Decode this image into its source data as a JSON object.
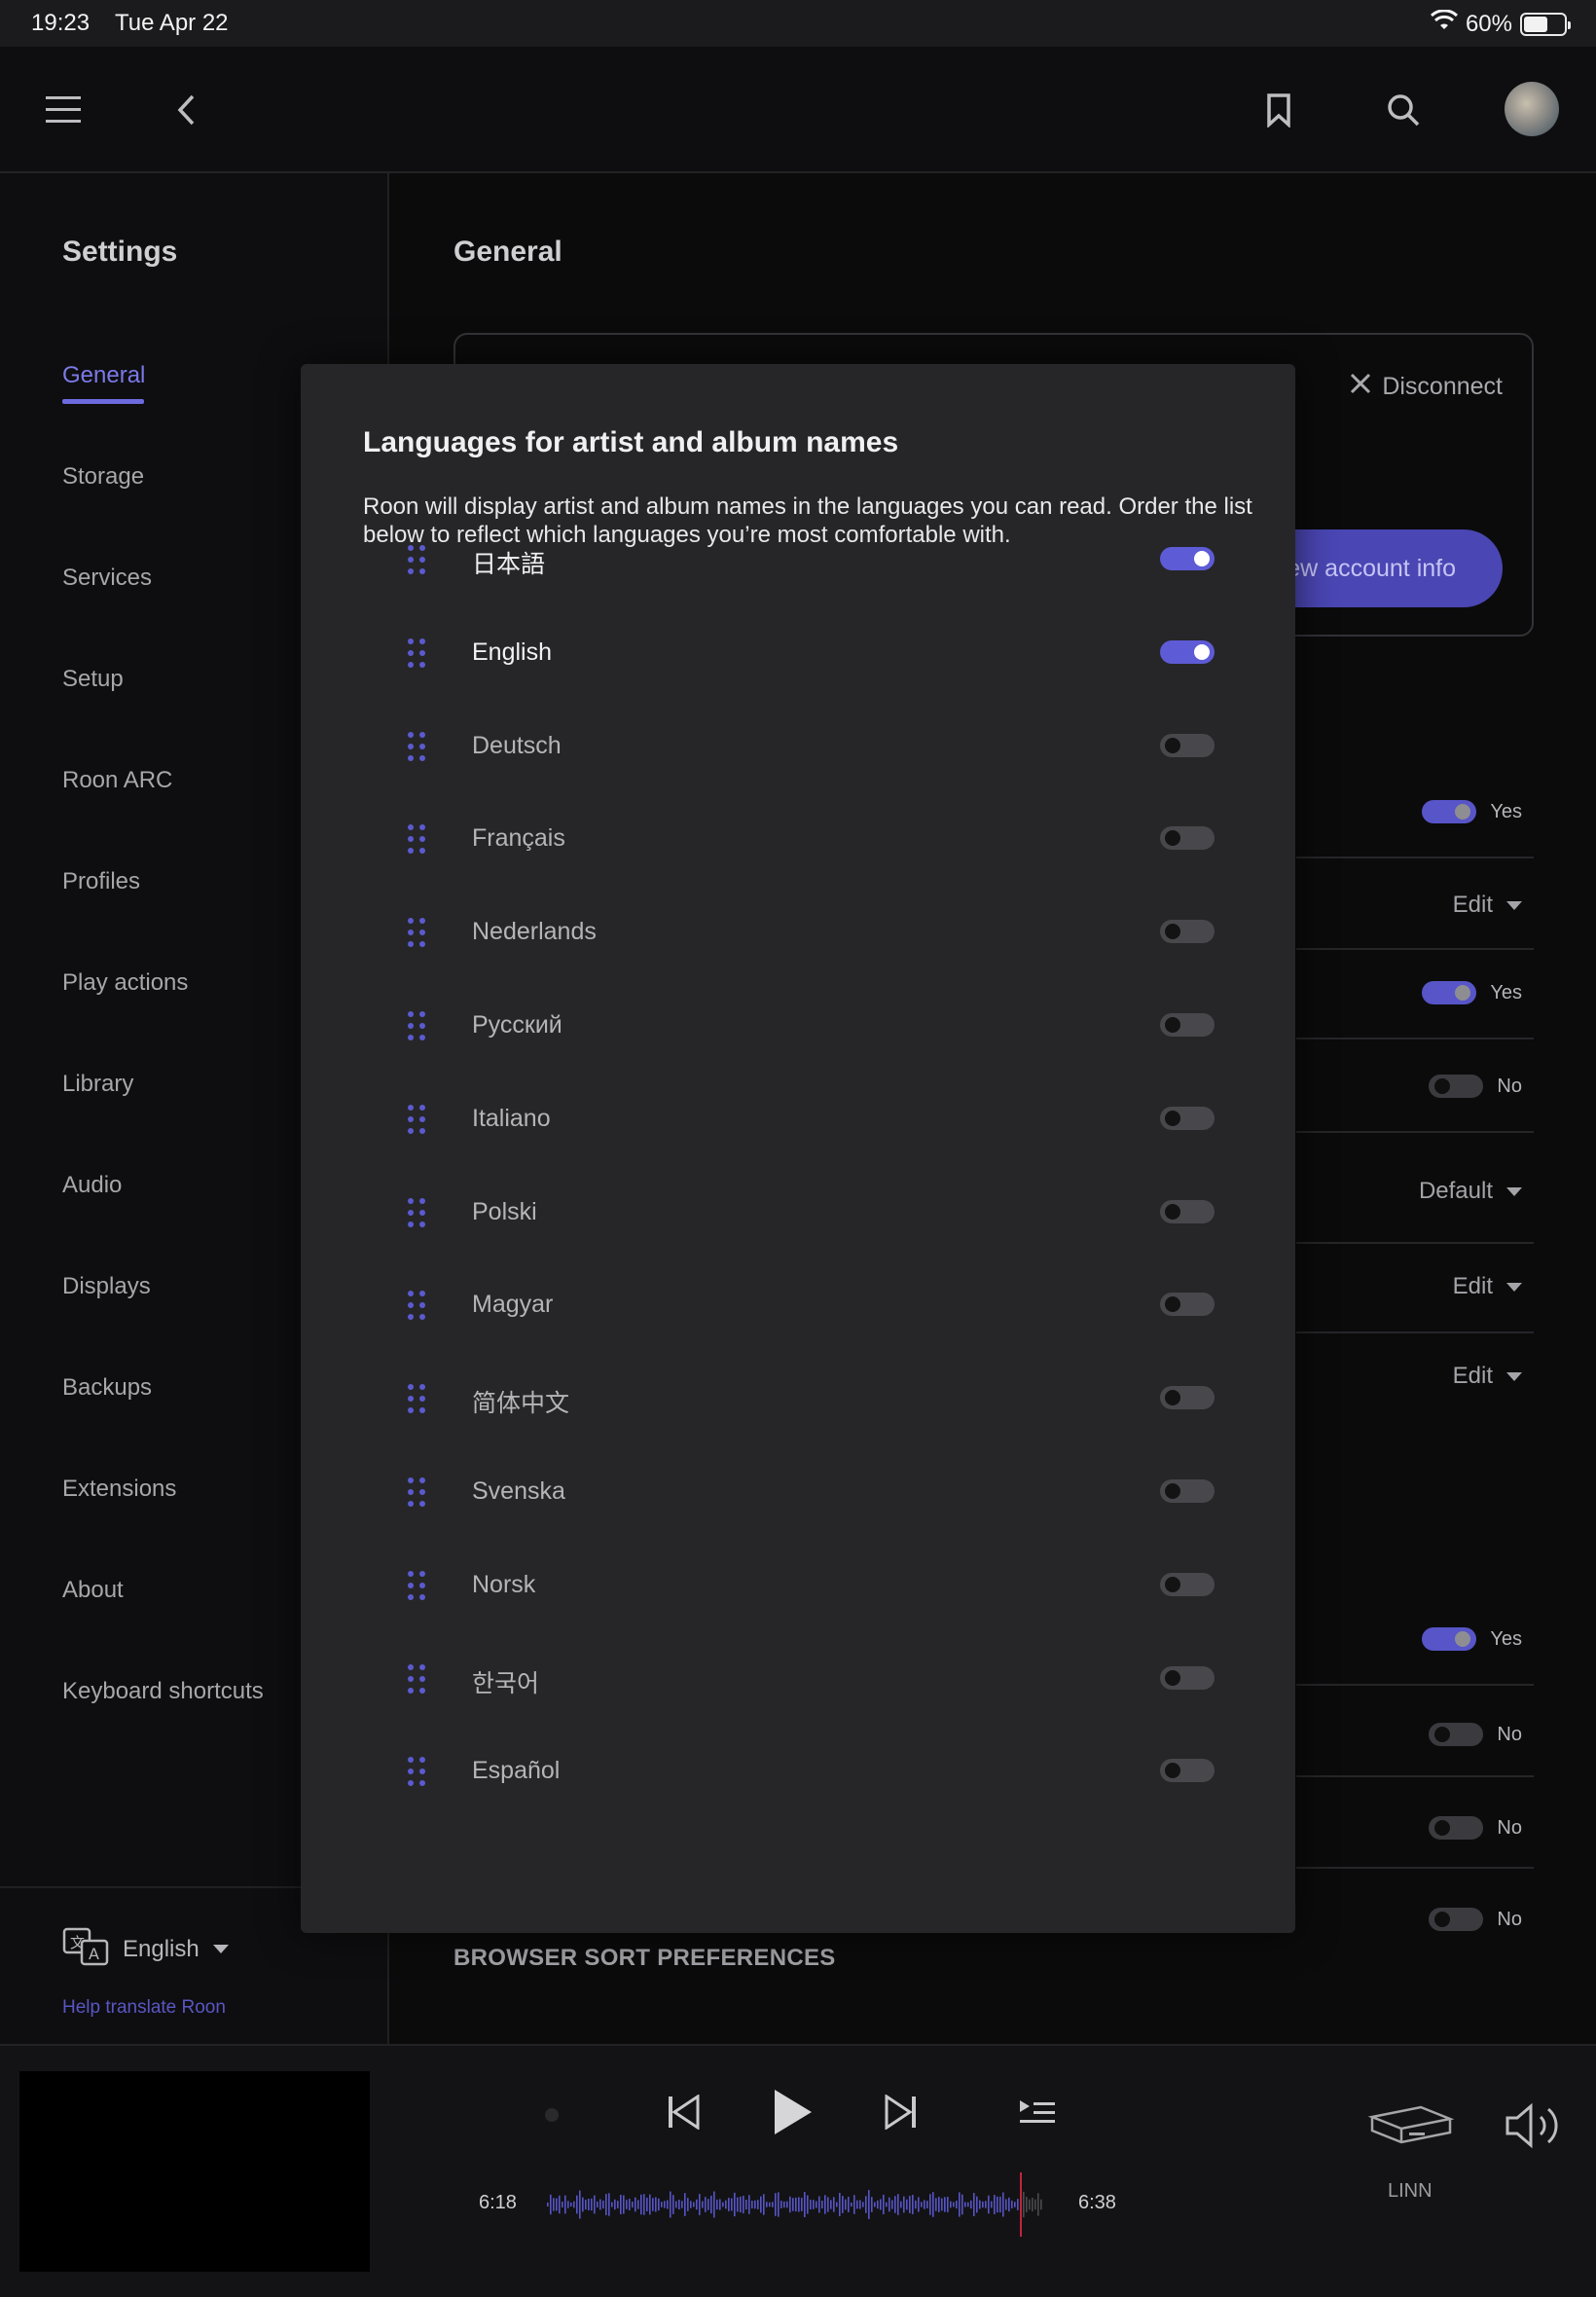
{
  "status_bar": {
    "time": "19:23",
    "date": "Tue Apr 22",
    "battery": "60%",
    "battery_level": 0.6
  },
  "top_nav": {
    "icons": [
      "hamburger-menu-icon",
      "back-chevron-icon",
      "bookmark-icon",
      "search-icon"
    ]
  },
  "sidebar": {
    "title": "Settings",
    "items": [
      {
        "label": "General",
        "active": true
      },
      {
        "label": "Storage"
      },
      {
        "label": "Services"
      },
      {
        "label": "Setup"
      },
      {
        "label": "Roon ARC"
      },
      {
        "label": "Profiles"
      },
      {
        "label": "Play actions"
      },
      {
        "label": "Library"
      },
      {
        "label": "Audio"
      },
      {
        "label": "Displays"
      },
      {
        "label": "Backups"
      },
      {
        "label": "Extensions"
      },
      {
        "label": "About"
      },
      {
        "label": "Keyboard shortcuts"
      }
    ],
    "language_selector": "English",
    "help_translate": "Help translate Roon"
  },
  "main": {
    "title": "General",
    "account": {
      "disconnect_label": "Disconnect",
      "view_account_label": "ew account info"
    },
    "settings_rows": [
      {
        "type": "toggle",
        "state": "on",
        "label": "Yes"
      },
      {
        "type": "dropdown",
        "label": "Edit"
      },
      {
        "type": "toggle",
        "state": "on",
        "label": "Yes"
      },
      {
        "type": "toggle",
        "state": "off",
        "label": "No"
      },
      {
        "type": "dropdown",
        "label": "Default"
      },
      {
        "type": "dropdown",
        "label": "Edit"
      },
      {
        "type": "dropdown",
        "label": "Edit"
      },
      {
        "type": "toggle",
        "state": "on",
        "label": "Yes"
      },
      {
        "type": "toggle",
        "state": "off",
        "label": "No"
      },
      {
        "type": "toggle",
        "state": "off",
        "label": "No"
      },
      {
        "type": "toggle",
        "state": "off",
        "label": "No"
      }
    ],
    "section_header": "BROWSER SORT PREFERENCES"
  },
  "modal": {
    "title": "Languages for artist and album names",
    "description": "Roon will display artist and album names in the languages you can read. Order the list below to reflect which languages you’re most comfortable with.",
    "languages": [
      {
        "name": "日本語",
        "enabled": true
      },
      {
        "name": "English",
        "enabled": true
      },
      {
        "name": "Deutsch",
        "enabled": false
      },
      {
        "name": "Français",
        "enabled": false
      },
      {
        "name": "Nederlands",
        "enabled": false
      },
      {
        "name": "Русский",
        "enabled": false
      },
      {
        "name": "Italiano",
        "enabled": false
      },
      {
        "name": "Polski",
        "enabled": false
      },
      {
        "name": "Magyar",
        "enabled": false
      },
      {
        "name": "简体中文",
        "enabled": false
      },
      {
        "name": "Svenska",
        "enabled": false
      },
      {
        "name": "Norsk",
        "enabled": false
      },
      {
        "name": "한국어",
        "enabled": false
      },
      {
        "name": "Español",
        "enabled": false
      }
    ]
  },
  "player": {
    "elapsed": "6:18",
    "total": "6:38",
    "progress": 0.95,
    "zone_name": "LINN",
    "accent_color": "#5755c7",
    "playhead_color": "#c0243a"
  }
}
